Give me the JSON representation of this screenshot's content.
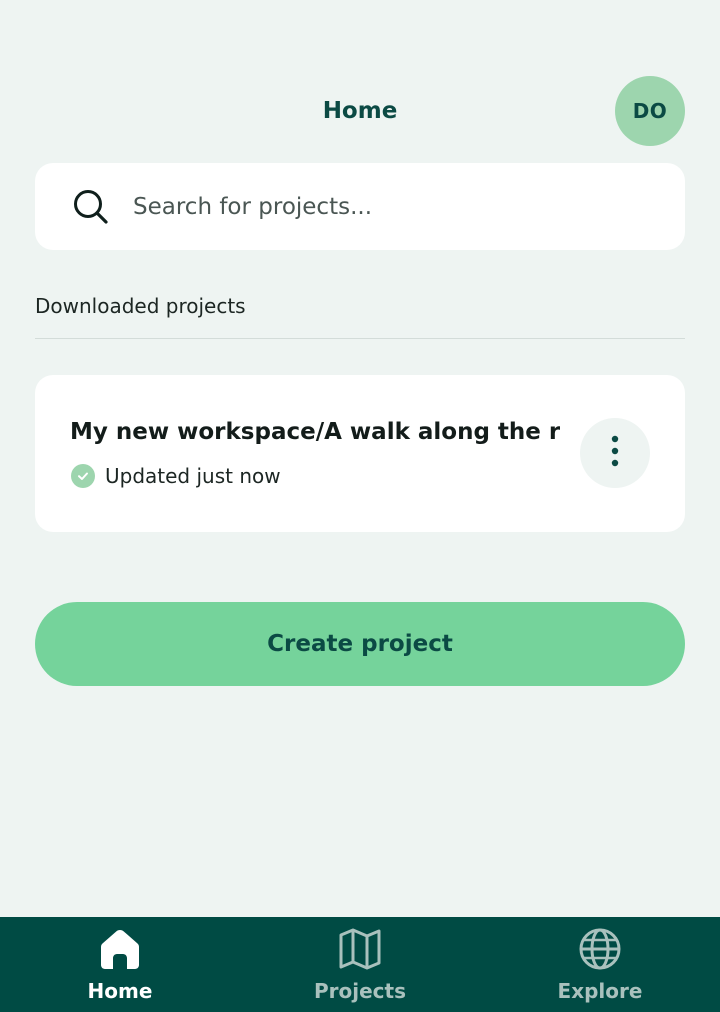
{
  "header": {
    "title": "Home",
    "avatar_initials": "DO"
  },
  "search": {
    "placeholder": "Search for projects...",
    "icon": "search-icon"
  },
  "downloaded": {
    "section_label": "Downloaded projects",
    "projects": [
      {
        "title": "My new workspace/A walk along the riv...",
        "status": "Updated just now",
        "status_icon": "check-circle-icon",
        "menu_icon": "more-vertical-icon"
      }
    ]
  },
  "actions": {
    "create_label": "Create project"
  },
  "bottom_nav": {
    "items": [
      {
        "label": "Home",
        "icon": "home-icon",
        "active": true
      },
      {
        "label": "Projects",
        "icon": "map-icon",
        "active": false
      },
      {
        "label": "Explore",
        "icon": "globe-icon",
        "active": false
      }
    ]
  },
  "colors": {
    "background": "#eef4f2",
    "primary_dark": "#004b44",
    "accent_green": "#75d39b",
    "avatar_green": "#9dd5ae",
    "title_text": "#0b4a44"
  }
}
